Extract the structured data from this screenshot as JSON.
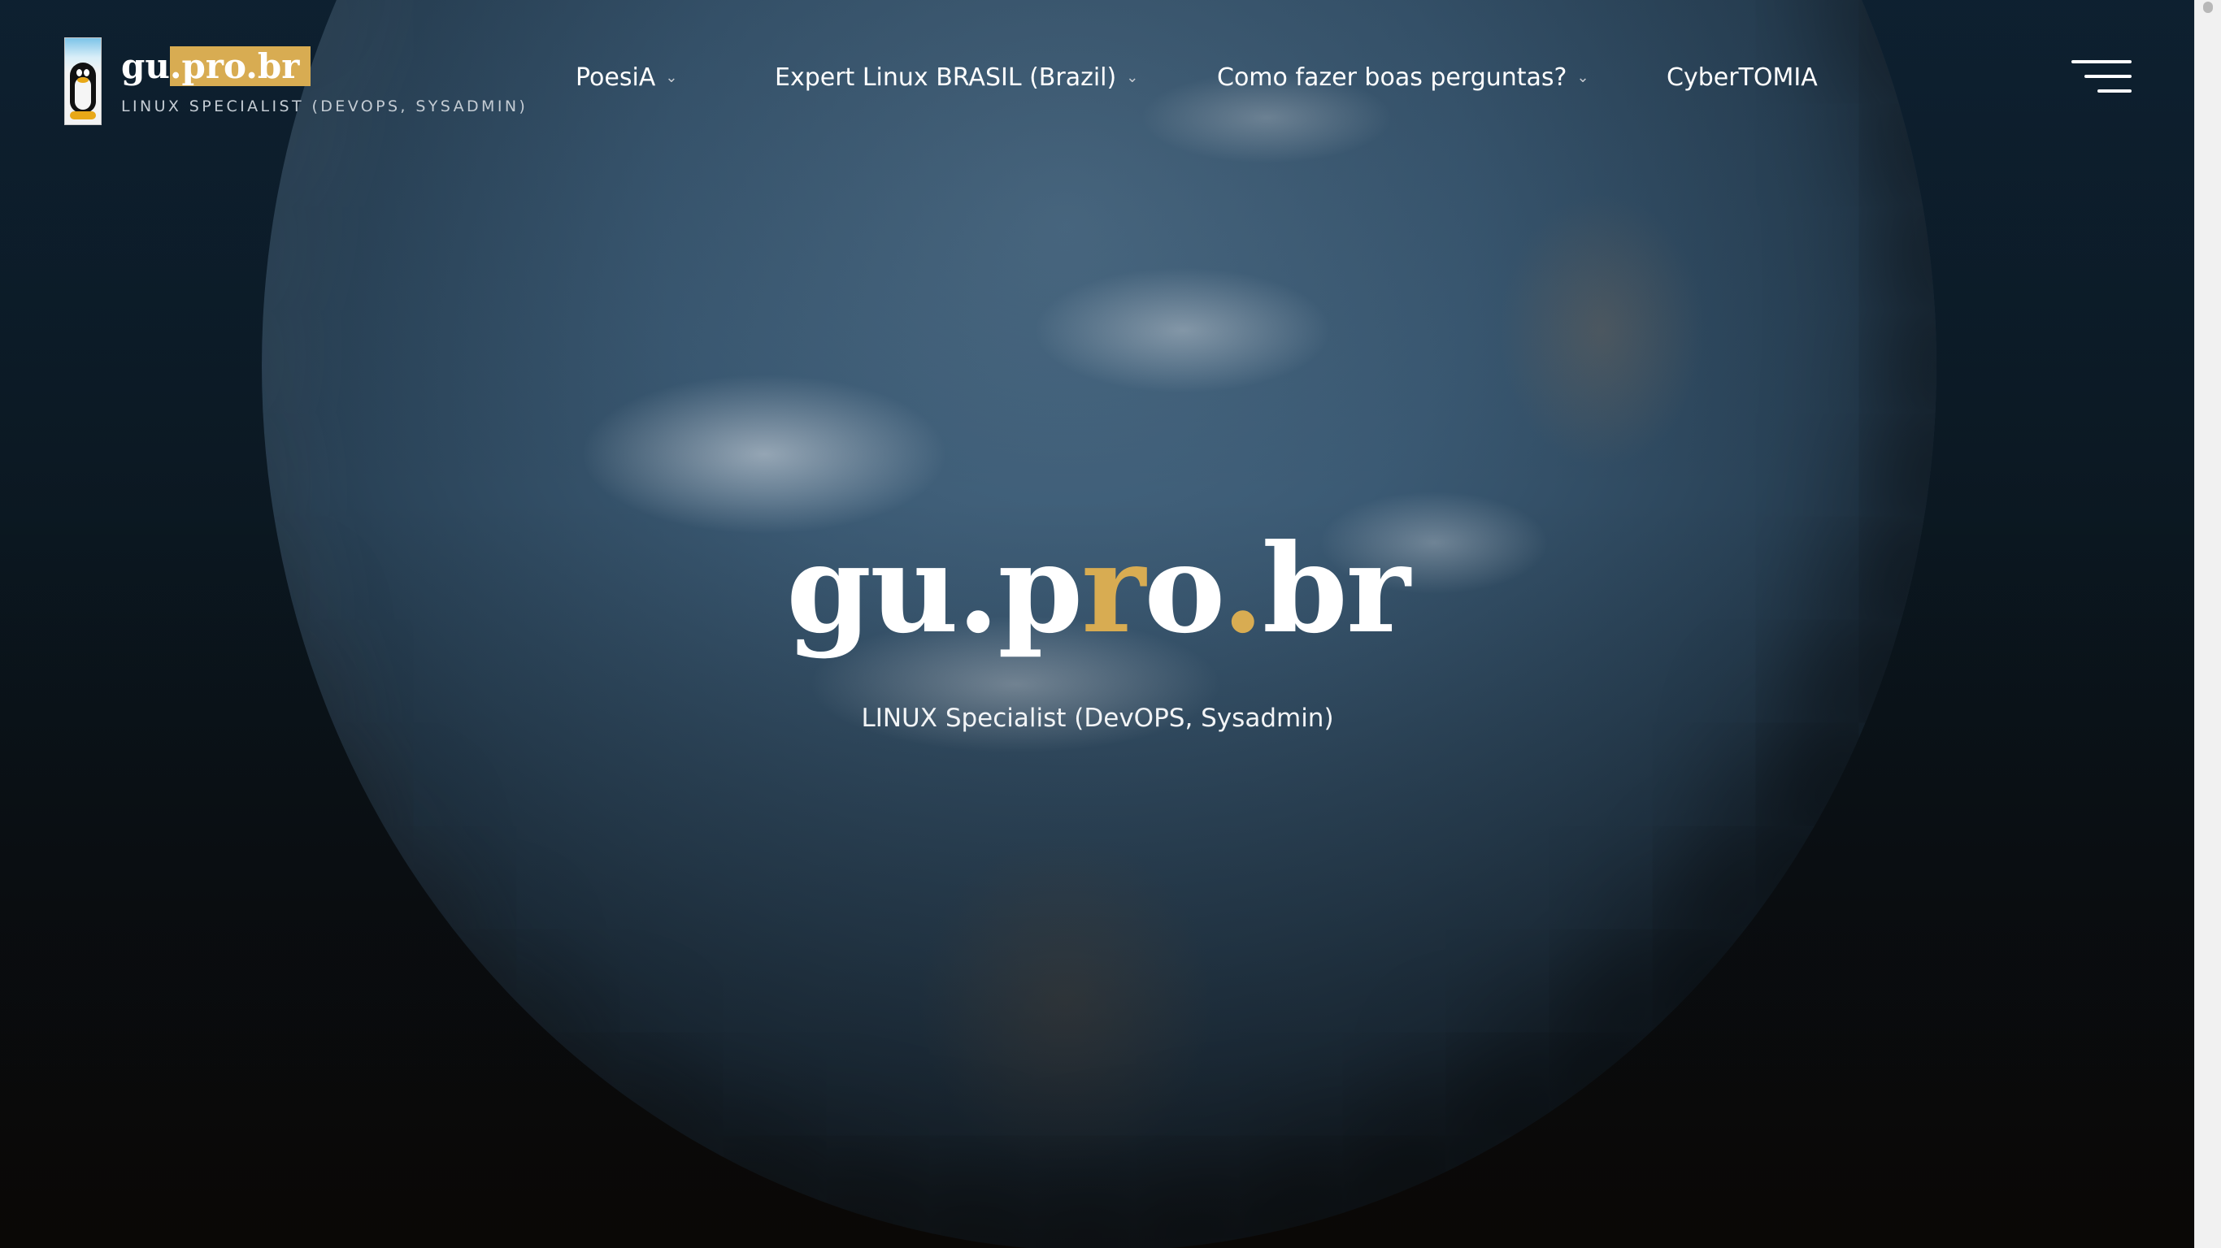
{
  "header": {
    "logo_icon": "tux-penguin-icon",
    "site_title_prefix": "gu",
    "site_title_highlight": ".pro.br",
    "site_tagline": "LINUX SPECIALIST (DEVOPS, SYSADMIN)"
  },
  "nav": {
    "items": [
      {
        "label": "PoesiA",
        "has_dropdown": true
      },
      {
        "label": "Expert Linux BRASIL (Brazil)",
        "has_dropdown": true
      },
      {
        "label": "Como fazer boas perguntas?",
        "has_dropdown": true
      },
      {
        "label": "CyberTOMIA",
        "has_dropdown": false
      }
    ],
    "dropdown_icon": "chevron-down-icon",
    "menu_icon": "hamburger-menu-icon"
  },
  "hero": {
    "title_parts": {
      "p1": "gu.p",
      "p2": "r",
      "p3": "o",
      "p4": ".",
      "p5": "br"
    },
    "subtitle": "LINUX Specialist (DevOPS, Sysadmin)",
    "background_image": "earth-from-space"
  },
  "colors": {
    "accent_gold": "#d8ac52",
    "text_white": "#ffffff"
  }
}
